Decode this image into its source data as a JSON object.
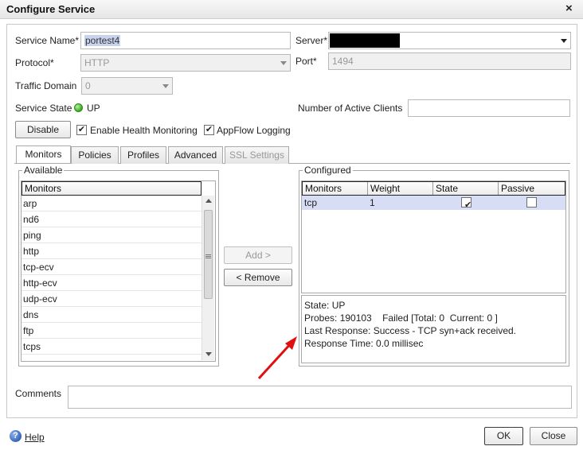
{
  "window": {
    "title": "Configure Service",
    "close_glyph": "×"
  },
  "form": {
    "service_name_label": "Service Name*",
    "service_name_value": "portest4",
    "server_label": "Server*",
    "protocol_label": "Protocol*",
    "protocol_value": "HTTP",
    "port_label": "Port*",
    "port_value": "1494",
    "traffic_domain_label": "Traffic Domain",
    "traffic_domain_value": "0",
    "service_state_label": "Service State",
    "service_state_value": "UP",
    "active_clients_label": "Number of Active Clients",
    "active_clients_value": "",
    "disable_button": "Disable",
    "health_monitoring_label": "Enable Health Monitoring",
    "appflow_label": "AppFlow Logging"
  },
  "tabs": [
    {
      "label": "Monitors"
    },
    {
      "label": "Policies"
    },
    {
      "label": "Profiles"
    },
    {
      "label": "Advanced"
    },
    {
      "label": "SSL Settings"
    }
  ],
  "available": {
    "legend": "Available",
    "header": "Monitors",
    "items": [
      "arp",
      "nd6",
      "ping",
      "http",
      "tcp-ecv",
      "http-ecv",
      "udp-ecv",
      "dns",
      "ftp",
      "tcps"
    ]
  },
  "buttons": {
    "add": "Add >",
    "remove": "< Remove",
    "ok": "OK",
    "close": "Close",
    "help": "Help"
  },
  "configured": {
    "legend": "Configured",
    "columns": [
      "Monitors",
      "Weight",
      "State",
      "Passive"
    ],
    "rows": [
      {
        "monitor": "tcp",
        "weight": "1"
      }
    ],
    "details": {
      "state": "State: UP",
      "probes": "Probes: 190103    Failed [Total: 0  Current: 0 ]",
      "last_response": "Last Response: Success - TCP syn+ack received.",
      "response_time": "Response Time: 0.0 millisec"
    }
  },
  "comments_label": "Comments",
  "colors": {
    "status_up": "#3aa621",
    "selected_row": "#d7ddf5",
    "annotation_arrow": "#e01010"
  }
}
